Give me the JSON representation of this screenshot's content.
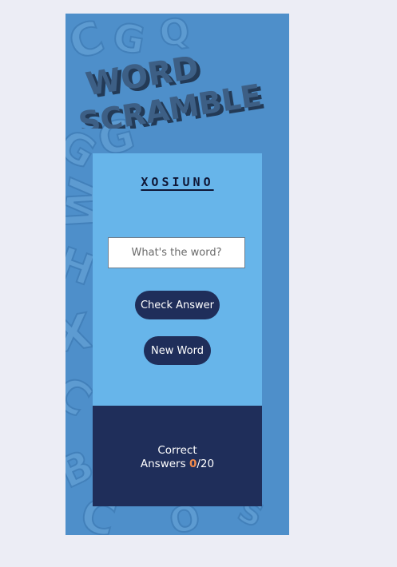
{
  "app": {
    "title_line1": "WORD",
    "title_line2": "SCRAMBLE"
  },
  "game": {
    "scrambled_word": "XOSIUNO",
    "input_placeholder": "What's the word?",
    "input_value": "",
    "check_button_label": "Check Answer",
    "new_word_button_label": "New Word"
  },
  "score": {
    "label_line1": "Correct",
    "label_line2": "Answers",
    "correct": "0",
    "separator": "/",
    "total": "20"
  },
  "colors": {
    "background": "#ecedf5",
    "phone_bg": "#4e8fca",
    "card_bg": "#67b5ea",
    "button_bg": "#1f2e5a",
    "score_panel_bg": "#1f2e5a",
    "score_highlight": "#f08a4b",
    "logo_face": "#3d5f85",
    "logo_side": "#233a56"
  }
}
